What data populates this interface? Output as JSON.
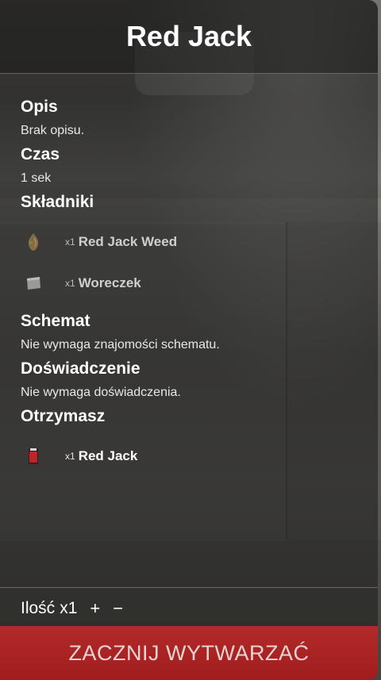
{
  "header": {
    "title": "Red Jack"
  },
  "sections": {
    "description": {
      "title": "Opis",
      "text": "Brak opisu."
    },
    "time": {
      "title": "Czas",
      "text": "1 sek"
    },
    "ingredients": {
      "title": "Składniki",
      "items": [
        {
          "qty": "x1",
          "name": "Red Jack Weed",
          "icon": "weed-bud-icon"
        },
        {
          "qty": "x1",
          "name": "Woreczek",
          "icon": "bag-icon"
        }
      ]
    },
    "schematic": {
      "title": "Schemat",
      "text": "Nie wymaga znajomości schematu."
    },
    "experience": {
      "title": "Doświadczenie",
      "text": "Nie wymaga doświadczenia."
    },
    "result": {
      "title": "Otrzymasz",
      "items": [
        {
          "qty": "x1",
          "name": "Red Jack",
          "icon": "red-jack-product-icon"
        }
      ]
    }
  },
  "footer": {
    "quantity_label": "Ilość",
    "quantity_value": "x1",
    "plus": "+",
    "minus": "−",
    "start_button": "ZACZNIJ WYTWARZAĆ"
  },
  "colors": {
    "accent": "#a82222",
    "text": "#ffffff"
  }
}
